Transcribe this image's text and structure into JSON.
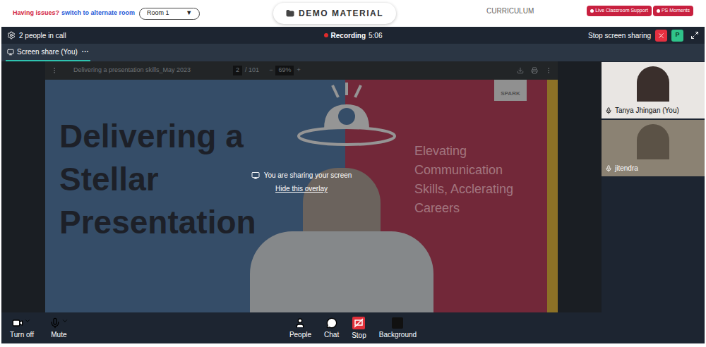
{
  "topbar": {
    "issue_text": "Having issues?",
    "switch_link": "switch to alternate room",
    "room": "Room 1",
    "room_caret": "▼",
    "demo_button": "DEMO MATERIAL",
    "curriculum": "CURRICULUM",
    "pills": [
      "Live Classroom Support",
      "PS Moments"
    ]
  },
  "call": {
    "people_count": "2 people in call",
    "recording_label": "Recording",
    "recording_time": "5:06",
    "stop_share": "Stop screen sharing",
    "avatar": "P"
  },
  "tabs": [
    {
      "label": "Screen share (You)",
      "more": "···",
      "selected": true
    }
  ],
  "pdf": {
    "title": "Delivering a presentation skills_May 2023",
    "page": "2",
    "total": "/ 101",
    "zoom_out": "−",
    "zoom": "69%",
    "zoom_in": "+"
  },
  "slide": {
    "title_lines": [
      "Delivering a",
      "Stellar",
      "Presentation"
    ],
    "subtitle_lines": [
      "Elevating",
      "Communication",
      "Skills, Acclerating",
      "Careers"
    ],
    "badge": "SPARK"
  },
  "overlay": {
    "message": "You are sharing your screen",
    "link": "Hide this overlay"
  },
  "participants": [
    {
      "name": "Tanya Jhingan (You)"
    },
    {
      "name": "jitendra"
    }
  ],
  "controls": [
    {
      "label": "Turn off",
      "kind": "video"
    },
    {
      "label": "Mute",
      "kind": "mic"
    },
    {
      "label": "People",
      "kind": "people"
    },
    {
      "label": "Chat",
      "kind": "chat"
    },
    {
      "label": "Stop",
      "kind": "stop"
    },
    {
      "label": "Background",
      "kind": "background"
    }
  ]
}
